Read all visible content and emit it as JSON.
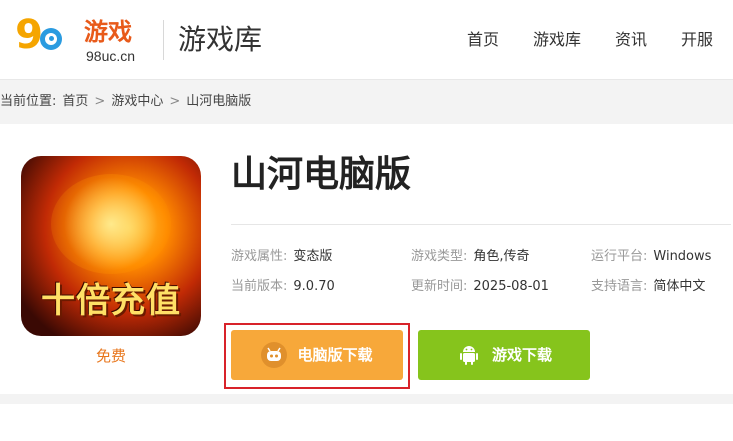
{
  "header": {
    "logo": {
      "brand": "游戏",
      "domain": "98uc.cn",
      "digits": "98"
    },
    "section_title": "游戏库",
    "nav": [
      "首页",
      "游戏库",
      "资讯",
      "开服"
    ]
  },
  "breadcrumb": {
    "prefix": "当前位置:",
    "items": [
      "首页",
      "游戏中心",
      "山河电脑版"
    ],
    "separator": ">"
  },
  "game": {
    "title": "山河电脑版",
    "icon_text": "十倍充值",
    "price_label": "免费",
    "info": [
      {
        "key": "游戏属性:",
        "value": "变态版"
      },
      {
        "key": "游戏类型:",
        "value": "角色,传奇"
      },
      {
        "key": "运行平台:",
        "value": "Windows"
      },
      {
        "key": "当前版本:",
        "value": "9.0.70"
      },
      {
        "key": "更新时间:",
        "value": "2025-08-01"
      },
      {
        "key": "支持语言:",
        "value": "简体中文"
      }
    ],
    "buttons": {
      "pc_download": "电脑版下载",
      "game_download": "游戏下载"
    }
  },
  "colors": {
    "pc_button": "#f7a83a",
    "android_button": "#86c41c",
    "highlight_outline": "#d8232a",
    "free_label": "#e8761c"
  }
}
